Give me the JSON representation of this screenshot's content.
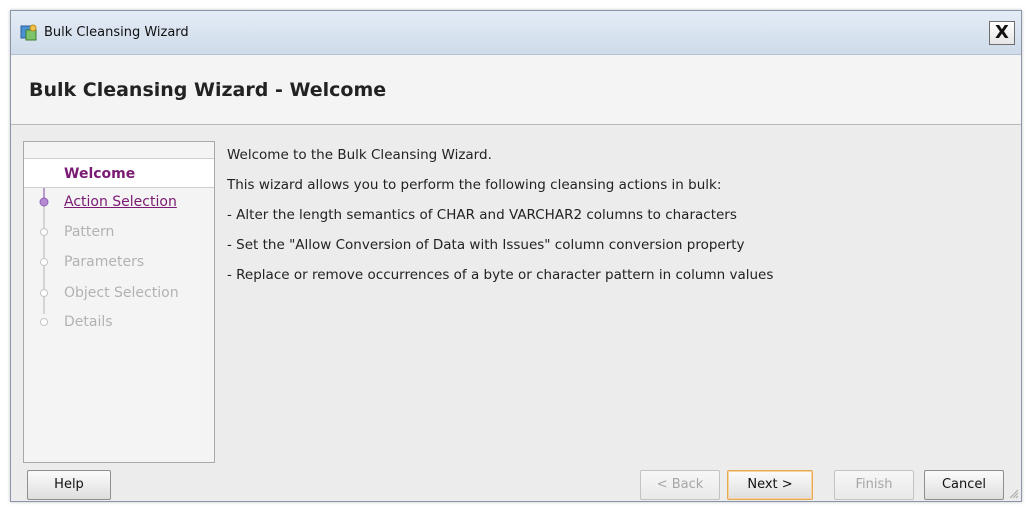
{
  "window": {
    "title": "Bulk Cleansing Wizard",
    "close_label": "X"
  },
  "header": {
    "title": "Bulk Cleansing Wizard - Welcome"
  },
  "steps": [
    {
      "label": "Welcome",
      "state": "current"
    },
    {
      "label": "Action Selection",
      "state": "link"
    },
    {
      "label": "Pattern",
      "state": "disabled"
    },
    {
      "label": "Parameters",
      "state": "disabled"
    },
    {
      "label": "Object Selection",
      "state": "disabled"
    },
    {
      "label": "Details",
      "state": "disabled"
    }
  ],
  "content": {
    "lines": [
      "Welcome to the Bulk Cleansing Wizard.",
      "This wizard allows you to perform the following cleansing actions in bulk:",
      "- Alter the length semantics of CHAR and VARCHAR2 columns to characters",
      "- Set the \"Allow Conversion of Data with Issues\" column conversion property",
      "- Replace or remove occurrences of a byte or character pattern in column values"
    ]
  },
  "buttons": {
    "help": "Help",
    "back": "< Back",
    "next": "Next >",
    "finish": "Finish",
    "cancel": "Cancel"
  },
  "colors": {
    "accent": "#7a1a72",
    "focus_border": "#e7a852"
  }
}
